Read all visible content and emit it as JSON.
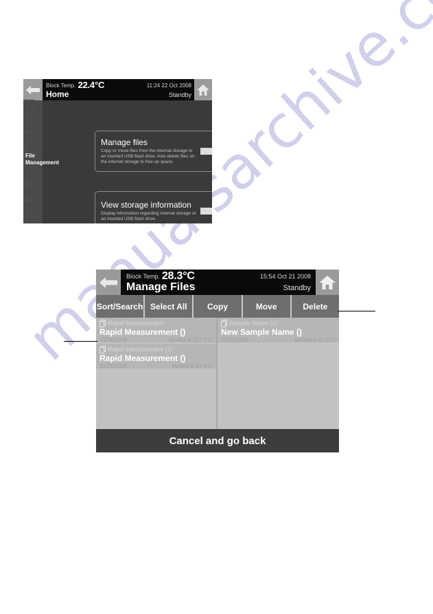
{
  "page": {
    "watermark": "manualsarchive.com"
  },
  "screens": [
    {
      "id": "home",
      "nav": {
        "back_icon": "back-arrow-icon",
        "home_icon": "home-icon"
      },
      "header": {
        "temp_label": "Block Temp.",
        "temp_value": "22.4°C",
        "clock": "11:24 22 Oct 2008",
        "title": "Home",
        "status": "Standby"
      },
      "rail": {
        "label": "File\nManagement",
        "ghost_text": "File Manager"
      },
      "cards": [
        {
          "title": "Manage files",
          "desc": "Copy or move files from the internal storage to an inserted USB flash drive. Also delete files on the internal storage to free up space.",
          "arrow_icon": "right-arrow-icon"
        },
        {
          "title": "View storage information",
          "desc": "Display information regarding internal storage or an inserted USB flash drive.",
          "arrow_icon": "right-arrow-icon"
        }
      ]
    },
    {
      "id": "manage-files",
      "nav": {
        "back_icon": "back-arrow-icon",
        "home_icon": "home-icon"
      },
      "header": {
        "temp_label": "Block Temp.",
        "temp_value": "28.3°C",
        "clock": "15:54 Oct 21 2008",
        "title": "Manage Files",
        "status": "Standby"
      },
      "toolbar": [
        {
          "label": "Sort/Search"
        },
        {
          "label": "Select All"
        },
        {
          "label": "Copy"
        },
        {
          "label": "Move"
        },
        {
          "label": "Delete"
        }
      ],
      "files_left": [
        {
          "origin": "Rapid Measurement",
          "name": "Rapid Measurement ()",
          "date": "10/16/2008",
          "result": "Melted at 227.2°C"
        },
        {
          "origin": "Rapid Measurement (1)",
          "name": "Rapid Measurement ()",
          "date": "10/21/2008",
          "result": "Melted at 97.4°C"
        }
      ],
      "files_right": [
        {
          "origin": "Sample Name (1)",
          "name": "New Sample Name ()",
          "date": "10/21/2008",
          "result": "Melted at 91.5°C"
        }
      ],
      "cancel_label": "Cancel and go back"
    }
  ]
}
